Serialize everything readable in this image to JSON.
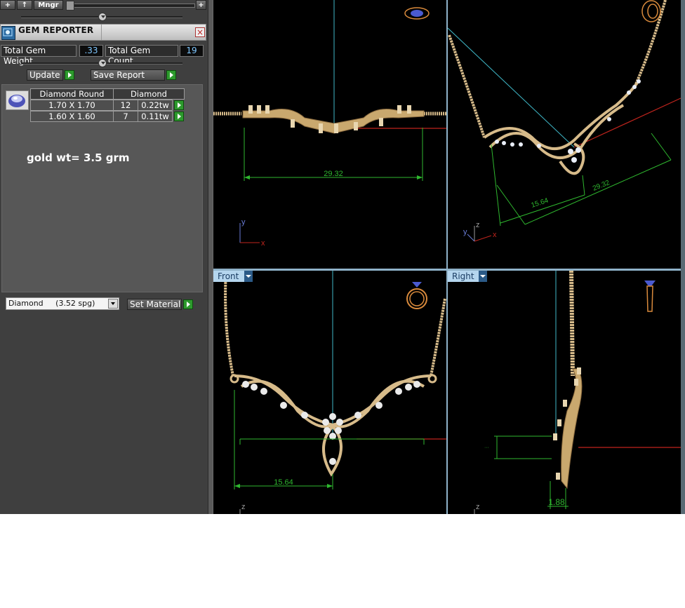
{
  "toolbar": {
    "add_label": "+",
    "up_label": "↑",
    "mngr_label": "Mngr",
    "plus_label": "+"
  },
  "gem_reporter": {
    "title": "GEM REPORTER",
    "close_label": "×",
    "total_weight_label": "Total Gem Weight",
    "total_weight_value": ".33",
    "total_count_label": "Total Gem Count",
    "total_count_value": "19",
    "update_label": "Update",
    "save_report_label": "Save Report",
    "table": {
      "headers": [
        "Diamond Round",
        "Diamond"
      ],
      "rows": [
        {
          "size": "1.70 X 1.70",
          "count": "12",
          "weight": "0.22tw"
        },
        {
          "size": "1.60 X 1.60",
          "count": "7",
          "weight": "0.11tw"
        }
      ]
    },
    "note": "gold wt= 3.5 grm",
    "material_value": "Diamond     (3.52 spg)",
    "set_material_label": "Set Material"
  },
  "viewports": {
    "top": {
      "dimension": "29.32",
      "axis_y": "y",
      "axis_x": "x"
    },
    "perspective": {
      "dim_a": "15.64",
      "dim_b": "29.32",
      "axis_y": "y",
      "axis_z": "z",
      "axis_x": "x"
    },
    "front": {
      "label": "Front",
      "dimension": "15.64",
      "axis_z": "z"
    },
    "right": {
      "label": "Right",
      "dimension": "1.88",
      "axis_z": "z"
    }
  },
  "colors": {
    "gold": "#d7bb8a",
    "gold_dark": "#8a6a3e",
    "dimension": "#2fb82f",
    "axis_red": "#c0241d",
    "axis_cyan": "#3fb8c8",
    "label_bg": "#b5d6ee"
  }
}
